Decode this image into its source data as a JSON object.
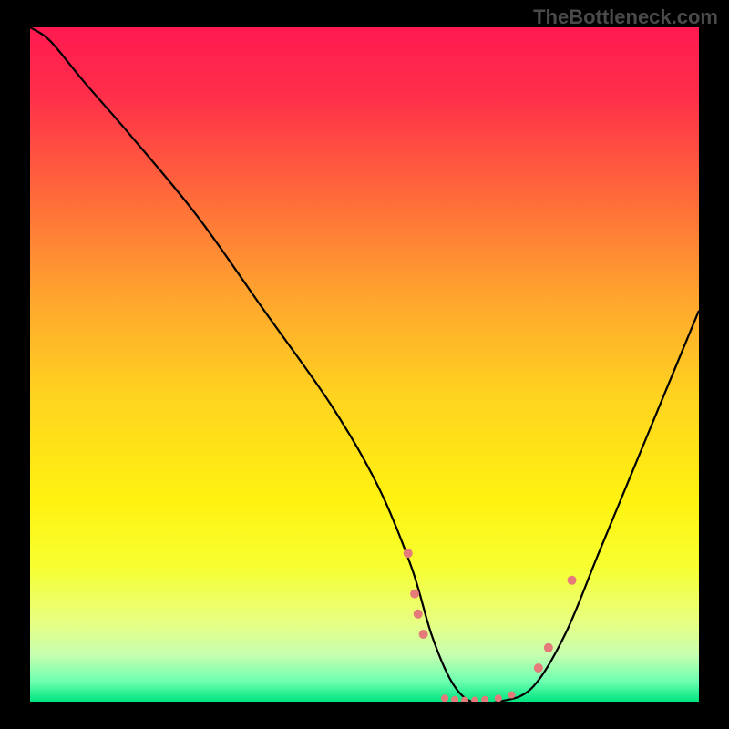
{
  "watermark": "TheBottleneck.com",
  "chart_data": {
    "type": "line",
    "title": "",
    "xlabel": "",
    "ylabel": "",
    "xlim": [
      0,
      100
    ],
    "ylim": [
      0,
      100
    ],
    "gradient_stops": [
      {
        "offset": 0.0,
        "color": "#ff1a50"
      },
      {
        "offset": 0.1,
        "color": "#ff2e4a"
      },
      {
        "offset": 0.25,
        "color": "#ff6a3a"
      },
      {
        "offset": 0.4,
        "color": "#ffa52e"
      },
      {
        "offset": 0.55,
        "color": "#ffd41f"
      },
      {
        "offset": 0.7,
        "color": "#fff210"
      },
      {
        "offset": 0.8,
        "color": "#f7ff30"
      },
      {
        "offset": 0.88,
        "color": "#e8ff80"
      },
      {
        "offset": 0.93,
        "color": "#c8ffb0"
      },
      {
        "offset": 0.97,
        "color": "#6dffb0"
      },
      {
        "offset": 1.0,
        "color": "#00e580"
      }
    ],
    "series": [
      {
        "name": "bottleneck-curve",
        "x": [
          0,
          3,
          8,
          15,
          25,
          35,
          45,
          52,
          57,
          60,
          63,
          66,
          70,
          75,
          80,
          85,
          90,
          95,
          100
        ],
        "y": [
          100,
          98,
          92,
          84,
          72,
          58,
          44,
          32,
          20,
          10,
          3,
          0,
          0,
          2,
          10,
          22,
          34,
          46,
          58
        ]
      }
    ],
    "markers": {
      "name": "highlight-points",
      "color": "#e47a7a",
      "points": [
        {
          "x": 56.5,
          "y": 22,
          "r": 5
        },
        {
          "x": 57.5,
          "y": 16,
          "r": 5
        },
        {
          "x": 58.0,
          "y": 13,
          "r": 5
        },
        {
          "x": 58.8,
          "y": 10,
          "r": 5
        },
        {
          "x": 62.0,
          "y": 0.5,
          "r": 4
        },
        {
          "x": 63.5,
          "y": 0.3,
          "r": 4
        },
        {
          "x": 65.0,
          "y": 0.2,
          "r": 4
        },
        {
          "x": 66.5,
          "y": 0.2,
          "r": 4
        },
        {
          "x": 68.0,
          "y": 0.3,
          "r": 4
        },
        {
          "x": 70.0,
          "y": 0.5,
          "r": 4
        },
        {
          "x": 72.0,
          "y": 1.0,
          "r": 4
        },
        {
          "x": 76.0,
          "y": 5,
          "r": 5
        },
        {
          "x": 77.5,
          "y": 8,
          "r": 5
        },
        {
          "x": 81.0,
          "y": 18,
          "r": 5
        }
      ]
    }
  }
}
